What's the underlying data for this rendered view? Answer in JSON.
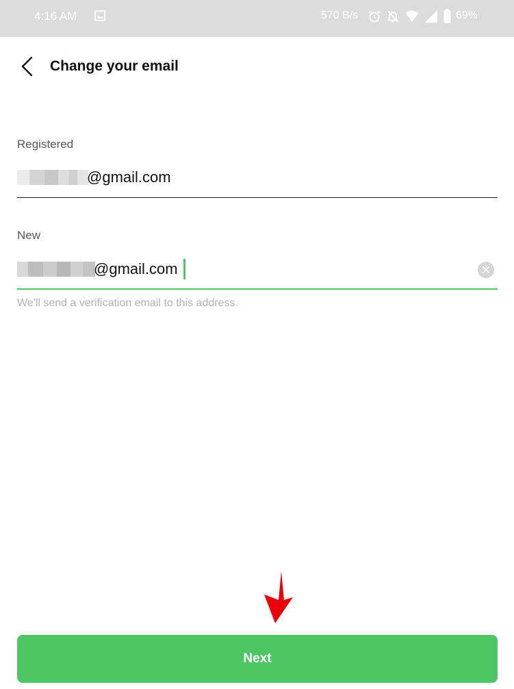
{
  "status_bar": {
    "time": "4:16 AM",
    "network_speed": "570 B/s",
    "battery_percent": "69%",
    "icons": [
      "image-icon",
      "alarm-icon",
      "mute-icon",
      "wifi-icon",
      "signal-icon",
      "battery-icon"
    ]
  },
  "header": {
    "back_icon": "chevron-left-icon",
    "title": "Change your email"
  },
  "registered_field": {
    "label": "Registered",
    "value_visible_suffix": "@gmail.com",
    "value_prefix_redacted": true
  },
  "new_field": {
    "label": "New",
    "value_visible_suffix": "@gmail.com",
    "value_prefix_redacted": true,
    "focused": true,
    "clear_icon": "clear-icon",
    "helper_text": "We'll send a verification email to this address."
  },
  "footer": {
    "next_label": "Next"
  },
  "colors": {
    "accent": "#4cc764",
    "status_bar_bg": "#dcdcdc",
    "annotation_arrow": "#e8000b"
  }
}
